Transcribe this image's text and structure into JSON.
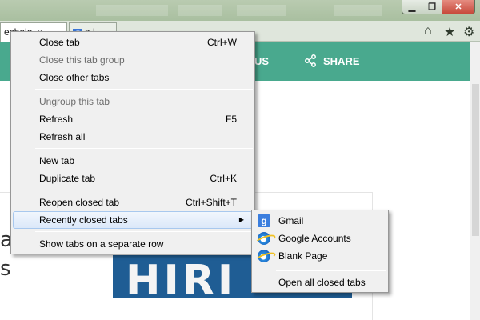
{
  "browser": {
    "tabs": [
      {
        "label": "echolo",
        "active": true
      },
      {
        "label": "a l",
        "active": false
      }
    ],
    "window_buttons": {
      "minimize": "▁",
      "maximize": "❐",
      "close": "✕"
    }
  },
  "page": {
    "nav": {
      "us_label": "US",
      "share_label": "SHARE"
    },
    "big_text_lines": [
      "a",
      "s"
    ],
    "hero_text": "HIRI",
    "brand_color": "#49a98e"
  },
  "context_menu": {
    "items": [
      {
        "label": "Close tab",
        "shortcut": "Ctrl+W",
        "disabled": false
      },
      {
        "label": "Close this tab group",
        "shortcut": "",
        "disabled": true
      },
      {
        "label": "Close other tabs",
        "shortcut": "",
        "disabled": false
      },
      {
        "label": "Ungroup this tab",
        "shortcut": "",
        "disabled": true
      },
      {
        "label": "Refresh",
        "shortcut": "F5",
        "disabled": false
      },
      {
        "label": "Refresh all",
        "shortcut": "",
        "disabled": false
      },
      {
        "label": "New tab",
        "shortcut": "",
        "disabled": false
      },
      {
        "label": "Duplicate tab",
        "shortcut": "Ctrl+K",
        "disabled": false
      },
      {
        "label": "Reopen closed tab",
        "shortcut": "Ctrl+Shift+T",
        "disabled": false
      },
      {
        "label": "Recently closed tabs",
        "shortcut": "",
        "disabled": false,
        "has_submenu": true,
        "highlighted": true
      },
      {
        "label": "Show tabs on a separate row",
        "shortcut": "",
        "disabled": false
      }
    ]
  },
  "submenu": {
    "items": [
      {
        "label": "Gmail",
        "icon": "google-icon"
      },
      {
        "label": "Google Accounts",
        "icon": "ie-icon"
      },
      {
        "label": "Blank Page",
        "icon": "ie-icon"
      },
      {
        "label": "Open all closed tabs",
        "icon": ""
      }
    ]
  }
}
